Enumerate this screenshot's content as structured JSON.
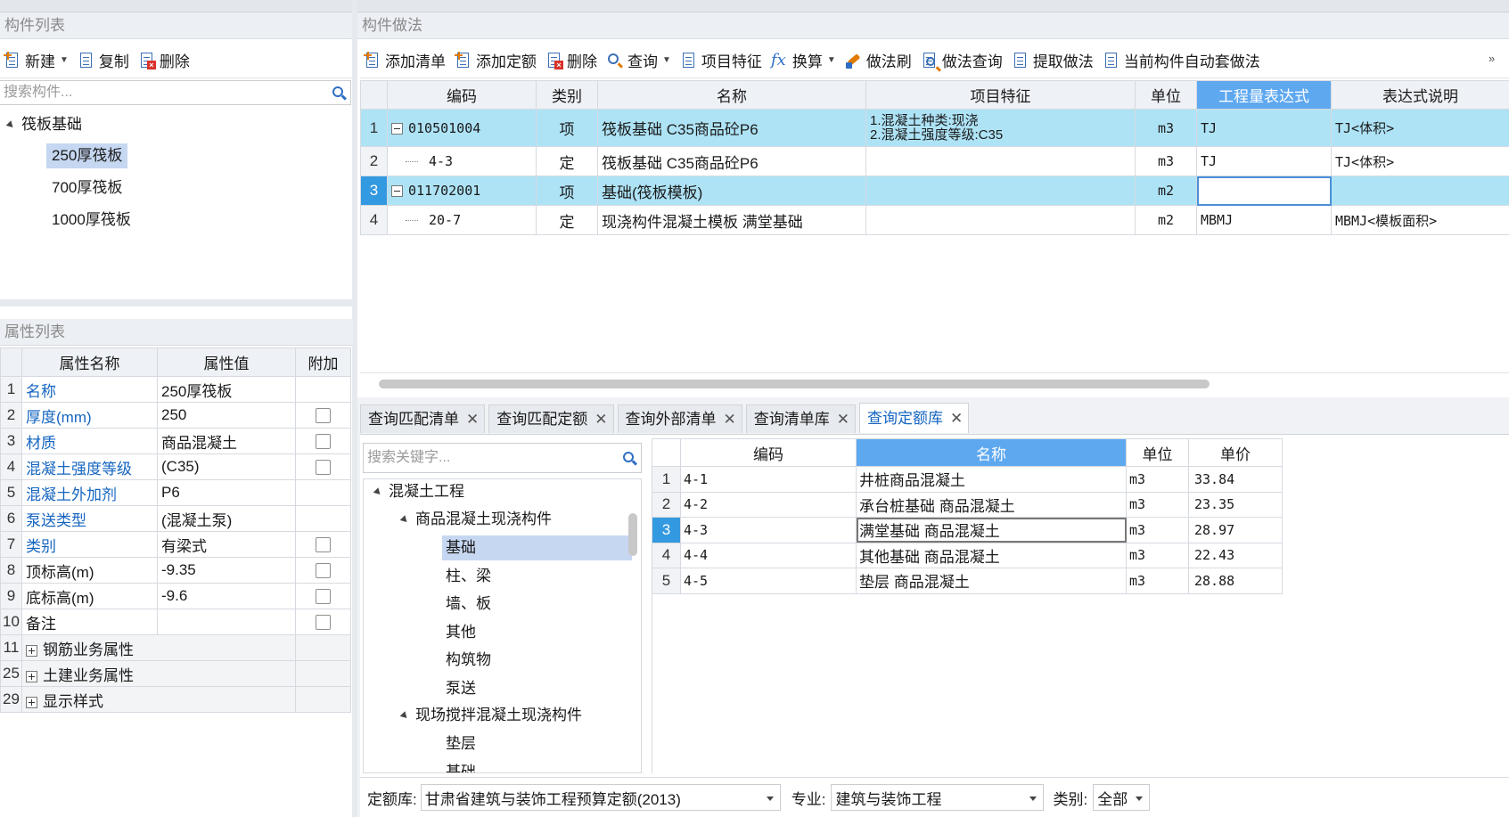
{
  "component_list": {
    "title": "构件列表",
    "toolbar": {
      "new": "新建",
      "copy": "复制",
      "delete": "删除"
    },
    "search_placeholder": "搜索构件...",
    "tree": {
      "root": "筏板基础",
      "children": [
        "250厚筏板",
        "700厚筏板",
        "1000厚筏板"
      ],
      "selected": "250厚筏板"
    }
  },
  "property_list": {
    "title": "属性列表",
    "headers": [
      "属性名称",
      "属性值",
      "附加"
    ],
    "rows": [
      {
        "num": "1",
        "name": "名称",
        "value": "250厚筏板",
        "blue": true,
        "checkbox": false
      },
      {
        "num": "2",
        "name": "厚度(mm)",
        "value": "250",
        "blue": true,
        "checkbox": true
      },
      {
        "num": "3",
        "name": "材质",
        "value": "商品混凝土",
        "blue": true,
        "checkbox": true
      },
      {
        "num": "4",
        "name": "混凝土强度等级",
        "value": "(C35)",
        "blue": true,
        "checkbox": true
      },
      {
        "num": "5",
        "name": "混凝土外加剂",
        "value": "P6",
        "blue": true,
        "checkbox": false
      },
      {
        "num": "6",
        "name": "泵送类型",
        "value": "(混凝土泵)",
        "blue": true,
        "checkbox": false
      },
      {
        "num": "7",
        "name": "类别",
        "value": "有梁式",
        "blue": true,
        "checkbox": true
      },
      {
        "num": "8",
        "name": "顶标高(m)",
        "value": "-9.35",
        "blue": false,
        "checkbox": true
      },
      {
        "num": "9",
        "name": "底标高(m)",
        "value": "-9.6",
        "blue": false,
        "checkbox": true
      },
      {
        "num": "10",
        "name": "备注",
        "value": "",
        "blue": false,
        "checkbox": true
      }
    ],
    "groups": [
      {
        "num": "11",
        "name": "钢筋业务属性"
      },
      {
        "num": "25",
        "name": "土建业务属性"
      },
      {
        "num": "29",
        "name": "显示样式"
      }
    ]
  },
  "method_panel": {
    "title": "构件做法",
    "toolbar": {
      "add_list": "添加清单",
      "add_quota": "添加定额",
      "delete": "删除",
      "query": "查询",
      "features": "项目特征",
      "convert": "换算",
      "brush": "做法刷",
      "method_query": "做法查询",
      "extract": "提取做法",
      "auto_apply": "当前构件自动套做法"
    },
    "headers": [
      "编码",
      "类别",
      "名称",
      "项目特征",
      "单位",
      "工程量表达式",
      "表达式说明"
    ],
    "rows": [
      {
        "num": "1",
        "code": "010501004",
        "type": "项",
        "name": "筏板基础 C35商品砼P6",
        "feature1": "1.混凝土种类:现浇",
        "feature2": "2.混凝土强度等级:C35",
        "unit": "m3",
        "expr": "TJ",
        "desc": "TJ<体积>",
        "expand": true,
        "highlight": true
      },
      {
        "num": "2",
        "code": "4-3",
        "type": "定",
        "name": "筏板基础 C35商品砼P6",
        "feature1": "",
        "feature2": "",
        "unit": "m3",
        "expr": "TJ",
        "desc": "TJ<体积>",
        "expand": false,
        "highlight": false
      },
      {
        "num": "3",
        "code": "011702001",
        "type": "项",
        "name": "基础(筏板模板)",
        "feature1": "",
        "feature2": "",
        "unit": "m2",
        "expr": "",
        "desc": "",
        "expand": true,
        "highlight": true
      },
      {
        "num": "4",
        "code": "20-7",
        "type": "定",
        "name": "现浇构件混凝土模板 满堂基础",
        "feature1": "",
        "feature2": "",
        "unit": "m2",
        "expr": "MBMJ",
        "desc": "MBMJ<模板面积>",
        "expand": false,
        "highlight": false
      }
    ]
  },
  "query_tabs": [
    {
      "label": "查询匹配清单",
      "active": false
    },
    {
      "label": "查询匹配定额",
      "active": false
    },
    {
      "label": "查询外部清单",
      "active": false
    },
    {
      "label": "查询清单库",
      "active": false
    },
    {
      "label": "查询定额库",
      "active": true
    }
  ],
  "quota_lib": {
    "search_placeholder": "搜索关键字...",
    "tree": {
      "root": "混凝土工程",
      "group1": "商品混凝土现浇构件",
      "group1_items": [
        "基础",
        "柱、梁",
        "墙、板",
        "其他",
        "构筑物",
        "泵送"
      ],
      "group2": "现场搅拌混凝土现浇构件",
      "group2_items": [
        "垫层",
        "基础"
      ],
      "selected": "基础"
    },
    "headers": [
      "编码",
      "名称",
      "单位",
      "单价"
    ],
    "rows": [
      {
        "num": "1",
        "code": "4-1",
        "name": "井桩商品混凝土",
        "unit": "m3",
        "price": "33.84"
      },
      {
        "num": "2",
        "code": "4-2",
        "name": "承台桩基础 商品混凝土",
        "unit": "m3",
        "price": "23.35"
      },
      {
        "num": "3",
        "code": "4-3",
        "name": "满堂基础 商品混凝土",
        "unit": "m3",
        "price": "28.97"
      },
      {
        "num": "4",
        "code": "4-4",
        "name": "其他基础 商品混凝土",
        "unit": "m3",
        "price": "22.43"
      },
      {
        "num": "5",
        "code": "4-5",
        "name": "垫层 商品混凝土",
        "unit": "m3",
        "price": "28.88"
      }
    ],
    "selected_row": "3",
    "footer": {
      "lib_label": "定额库:",
      "lib_value": "甘肃省建筑与装饰工程预算定额(2013)",
      "major_label": "专业:",
      "major_value": "建筑与装饰工程",
      "category_label": "类别:",
      "category_value": "全部"
    }
  },
  "colors": {
    "row_highlight": "#aee3f6",
    "header_selected": "#5ea8f0",
    "link_blue": "#1565c0",
    "tree_selected": "#c6d7f1"
  }
}
